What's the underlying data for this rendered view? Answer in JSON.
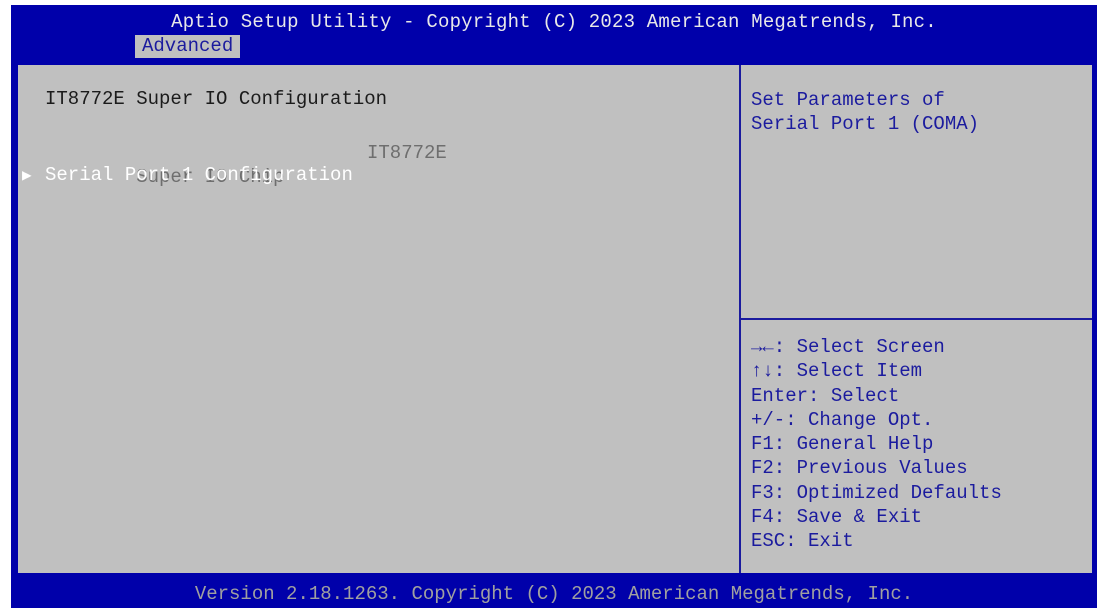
{
  "header": {
    "title": "Aptio Setup Utility - Copyright (C) 2023 American Megatrends, Inc.",
    "active_tab": "Advanced"
  },
  "main": {
    "heading": "IT8772E Super IO Configuration",
    "items": [
      {
        "label": "Super IO Chip",
        "value": "IT8772E"
      },
      {
        "label": "Serial Port 1 Configuration",
        "value": ""
      }
    ],
    "submenu_arrow": "▶"
  },
  "help": {
    "text": "Set Parameters of\nSerial Port 1 (COMA)"
  },
  "keys": [
    "→←: Select Screen",
    "↑↓: Select Item",
    "Enter: Select",
    "+/-: Change Opt.",
    "F1: General Help",
    "F2: Previous Values",
    "F3: Optimized Defaults",
    "F4: Save & Exit",
    "ESC: Exit"
  ],
  "footer": {
    "text": "Version 2.18.1263. Copyright (C) 2023 American Megatrends, Inc."
  },
  "colors": {
    "frame_blue": "#0000aa",
    "panel_gray": "#c0c0c0",
    "help_text_blue": "#1b1b9e",
    "selected_text": "#ffffff",
    "disabled_text": "#6e6e6e"
  }
}
